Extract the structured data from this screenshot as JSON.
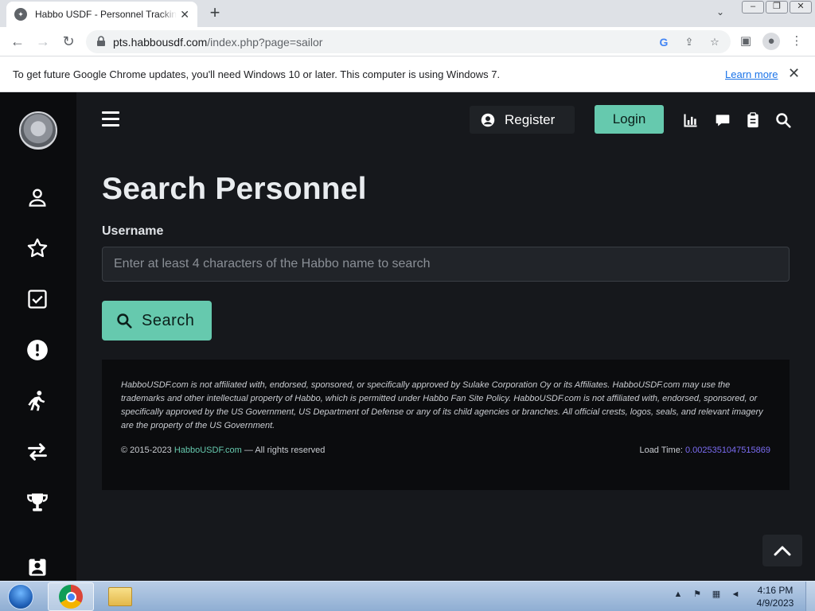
{
  "browser": {
    "tab_title": "Habbo USDF - Personnel Tracking",
    "url_host": "pts.habbousdf.com",
    "url_path": "/index.php?page=sailor",
    "infobar_text": "To get future Google Chrome updates, you'll need Windows 10 or later. This computer is using Windows 7.",
    "infobar_link": "Learn more"
  },
  "header": {
    "register_label": "Register",
    "login_label": "Login"
  },
  "main": {
    "title": "Search Personnel",
    "username_label": "Username",
    "username_placeholder": "Enter at least 4 characters of the Habbo name to search",
    "username_value": "",
    "search_button": "Search"
  },
  "footer": {
    "disclaimer": "HabboUSDF.com is not affiliated with, endorsed, sponsored, or specifically approved by Sulake Corporation Oy or its Affiliates. HabboUSDF.com may use the trademarks and other intellectual property of Habbo, which is permitted under Habbo Fan Site Policy. HabboUSDF.com is not affiliated with, endorsed, sponsored, or specifically approved by the US Government, US Department of Defense or any of its child agencies or branches. All official crests, logos, seals, and relevant imagery are the property of the US Government.",
    "copyright_prefix": "© 2015-2023",
    "copyright_link": "HabboUSDF.com",
    "copyright_suffix": "— All rights reserved",
    "load_time_label": "Load Time:",
    "load_time_value": "0.0025351047515869"
  },
  "taskbar": {
    "time": "4:16 PM",
    "date": "4/9/2023"
  },
  "colors": {
    "accent": "#66c9ae",
    "page_bg": "#16181c",
    "sidebar_bg": "#0b0c0e",
    "load_time": "#7b6cf2"
  },
  "icons": {
    "sidebar": [
      "person-icon",
      "star-icon",
      "checkbox-icon",
      "alert-icon",
      "running-icon",
      "transfer-icon",
      "trophy-icon",
      "id-badge-icon"
    ],
    "header": [
      "chart-icon",
      "chat-icon",
      "clipboard-icon",
      "search-icon"
    ]
  }
}
